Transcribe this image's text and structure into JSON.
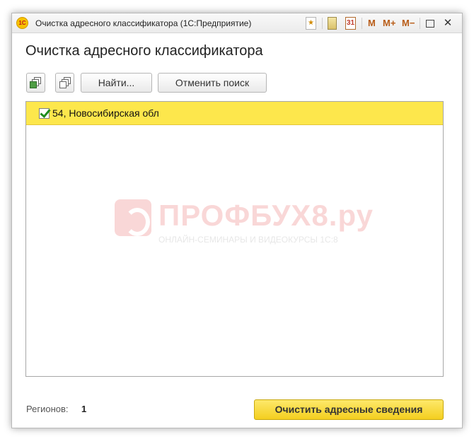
{
  "window": {
    "title": "Очистка адресного классификатора  (1С:Предприятие)",
    "app_logo": "1С"
  },
  "titlebar_icons": {
    "favorite_icon": "star-icon",
    "calculator_icon": "calculator-icon",
    "calendar_icon": "calendar-icon",
    "calendar_day": "31",
    "m_label": "M",
    "m_plus_label": "M+",
    "m_minus_label": "M−",
    "restore_icon": "restore-icon",
    "close_icon": "close-icon",
    "close_glyph": "✕"
  },
  "form": {
    "title": "Очистка адресного классификатора"
  },
  "toolbar": {
    "check_all_icon": "check-all-icon",
    "uncheck_all_icon": "uncheck-all-icon",
    "find_label": "Найти...",
    "cancel_search_label": "Отменить поиск"
  },
  "list": {
    "items": [
      {
        "label": "54, Новосибирская обл",
        "checked": true,
        "selected": true
      }
    ]
  },
  "watermark": {
    "name": "ПРОФБУХ8.ру",
    "tagline": "ОНЛАЙН-СЕМИНАРЫ И ВИДЕОКУРСЫ 1С:8"
  },
  "footer": {
    "regions_label": "Регионов:",
    "regions_count": "1",
    "clear_button_label": "Очистить адресные сведения"
  },
  "colors": {
    "selection": "#fde74c",
    "primary_button": "#f4cf1f",
    "memory_buttons": "#b85c17"
  }
}
